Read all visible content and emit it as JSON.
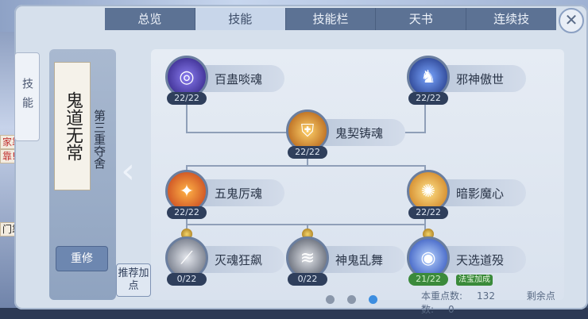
{
  "tabs": [
    "总览",
    "技能",
    "技能栏",
    "天书",
    "连续技"
  ],
  "active_tab": 1,
  "close_symbol": "✕",
  "side_tab_label": "技能",
  "left_fragments": [
    "家靠",
    "靠! ",
    "门靠朋"
  ],
  "path": {
    "scroll_text": "鬼道无常",
    "name": "第三重夺舍",
    "reset_label": "重修",
    "recommend_label": "推荐加点"
  },
  "skills": [
    {
      "name": "百蛊啖魂",
      "points": "22/22",
      "icon": "purple-orb-icon"
    },
    {
      "name": "邪神傲世",
      "points": "22/22",
      "icon": "blue-figure-icon"
    },
    {
      "name": "鬼契铸魂",
      "points": "22/22",
      "icon": "gold-shield-icon"
    },
    {
      "name": "五鬼厉魂",
      "points": "22/22",
      "icon": "fire-slash-icon"
    },
    {
      "name": "暗影魔心",
      "points": "22/22",
      "icon": "golden-burst-icon"
    },
    {
      "name": "灭魂狂飙",
      "points": "0/22",
      "icon": "grey-blades-icon"
    },
    {
      "name": "神鬼乱舞",
      "points": "0/22",
      "icon": "grey-claw-icon"
    },
    {
      "name": "天选道殁",
      "points": "21/22",
      "icon": "blue-sphere-icon",
      "badge": "法宝加成"
    }
  ],
  "stats": {
    "layer_points_label": "本重点数:",
    "layer_points": "132",
    "remaining_label": "剩余点数:",
    "remaining": "0"
  },
  "page_indicator": {
    "count": 3,
    "active": 2
  },
  "colors": {
    "accent": "#3d8ee0",
    "tab_active": "#c8d6ea",
    "tab": "#5c7294",
    "badge": "#3a8a3a"
  }
}
